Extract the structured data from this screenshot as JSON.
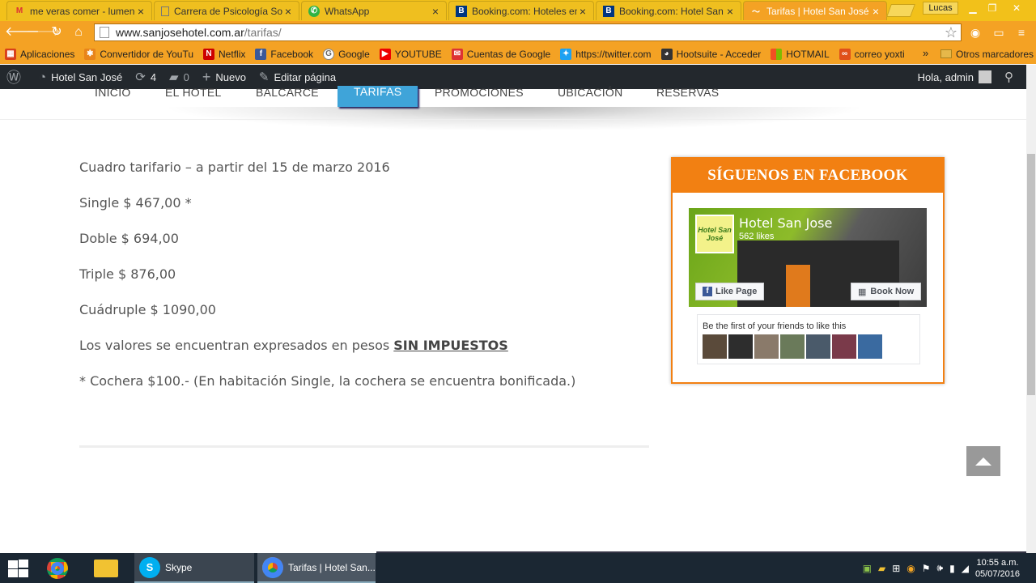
{
  "browser": {
    "tabs": [
      {
        "label": "me veras comer - lumend",
        "icon": "gmail-icon",
        "active": false
      },
      {
        "label": "Carrera de Psicología Soc",
        "icon": "page-icon",
        "active": false
      },
      {
        "label": "WhatsApp",
        "icon": "whatsapp-icon",
        "active": false
      },
      {
        "label": "Booking.com: Hoteles en",
        "icon": "booking-icon",
        "active": false
      },
      {
        "label": "Booking.com: Hotel San J",
        "icon": "booking-icon",
        "active": false
      },
      {
        "label": "Tarifas | Hotel San José",
        "icon": "hotel-icon",
        "active": true
      }
    ],
    "profile_name": "Lucas",
    "url_host": "www.sanjosehotel.com.ar",
    "url_path": "/tarifas/",
    "bookmarks": [
      {
        "label": "Aplicaciones",
        "icon": "apps-icon",
        "color": "#d9401a"
      },
      {
        "label": "Convertidor de YouTu",
        "icon": "converter-icon",
        "color": "#e8841a"
      },
      {
        "label": "Netflix",
        "icon": "netflix-icon",
        "color": "#c00"
      },
      {
        "label": "Facebook",
        "icon": "facebook-icon",
        "color": "#3b5998"
      },
      {
        "label": "Google",
        "icon": "google-icon",
        "color": "#666"
      },
      {
        "label": "YOUTUBE",
        "icon": "youtube-icon",
        "color": "#e00"
      },
      {
        "label": "Cuentas de Google",
        "icon": "mail-icon",
        "color": "#d33"
      },
      {
        "label": "https://twitter.com",
        "icon": "twitter-icon",
        "color": "#1da1f2"
      },
      {
        "label": "Hootsuite - Acceder",
        "icon": "hootsuite-icon",
        "color": "#333"
      },
      {
        "label": "HOTMAIL",
        "icon": "windows-icon",
        "color": "#f25022"
      },
      {
        "label": "correo yoxti",
        "icon": "yoxti-icon",
        "color": "#e0501a"
      }
    ],
    "bookmarks_more": "»",
    "other_bookmarks": "Otros marcadores"
  },
  "wp_admin_bar": {
    "site_name": "Hotel San José",
    "updates": "4",
    "comments": "0",
    "new_label": "Nuevo",
    "edit_label": "Editar página",
    "greeting": "Hola, admin"
  },
  "menu": {
    "items": [
      "INICIO",
      "EL HOTEL",
      "BALCARCE",
      "TARIFAS",
      "PROMOCIONES",
      "UBICACIÓN",
      "RESERVAS"
    ]
  },
  "content": {
    "title_line": "Cuadro tarifario – a partir del 15 de marzo 2016",
    "single": "Single $ 467,00 *",
    "doble": "Doble $ 694,00",
    "triple": "Triple $ 876,00",
    "cuadruple": "Cuádruple $ 1090,00",
    "taxes_prefix": "Los valores se encuentran expresados en pesos ",
    "taxes_strong": "SIN IMPUESTOS",
    "note": "* Cochera $100.- (En habitación Single, la cochera se encuentra bonificada.)"
  },
  "facebook_widget": {
    "heading": "SÍGUENOS EN FACEBOOK",
    "page_name": "Hotel San Jose",
    "likes": "562 likes",
    "logo_text": "Hotel San José",
    "like_button": "Like Page",
    "book_button": "Book Now",
    "friends_text": "Be the first of your friends to like this",
    "face_colors": [
      "#5a4a3a",
      "#2d2d2d",
      "#8a7a6a",
      "#6a7a5a",
      "#4a5a6a",
      "#7a3a4a",
      "#3a6aa0"
    ]
  },
  "taskbar": {
    "apps": [
      {
        "label": "",
        "icon": "chrome-icon"
      },
      {
        "label": "",
        "icon": "file-explorer-icon"
      },
      {
        "label": "Skype",
        "icon": "skype-icon"
      },
      {
        "label": "Tarifas | Hotel San...",
        "icon": "chrome-icon"
      }
    ],
    "time": "10:55 a.m.",
    "date": "05/07/2016"
  },
  "colors": {
    "browser_orange": "#f4a224",
    "wp_bar": "#23282d",
    "menu_active": "#3fa4d9",
    "fb_orange": "#f28012",
    "facebook_blue": "#3b5998"
  }
}
